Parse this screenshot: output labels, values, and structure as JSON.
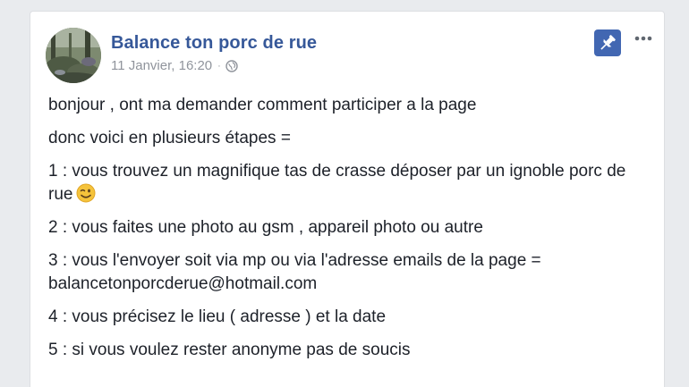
{
  "post": {
    "page_name": "Balance ton porc de rue",
    "timestamp": "11 Janvier, 16:20",
    "separator": "·",
    "privacy_icon": "globe-icon",
    "pin_icon": "pin-icon",
    "more_icon": "more-options-icon",
    "lines": [
      "bonjour , ont ma demander comment participer a la page",
      "donc voici en plusieurs étapes =",
      "1 : vous trouvez un magnifique tas de crasse déposer par un ignoble porc de rue",
      "2 : vous faites une photo au gsm , appareil photo ou autre",
      "3 : vous l'envoyer soit via mp ou via l'adresse emails de la page = balancetonporcderue@hotmail.com",
      "4 : vous précisez le lieu ( adresse ) et la date",
      "5 : si vous voulez rester anonyme pas de soucis"
    ],
    "emoji": "wink-emoji-icon"
  },
  "colors": {
    "link": "#365899",
    "meta": "#90949c",
    "text": "#1d2129",
    "pin_button": "#4267b2",
    "background": "#e9ebee"
  }
}
